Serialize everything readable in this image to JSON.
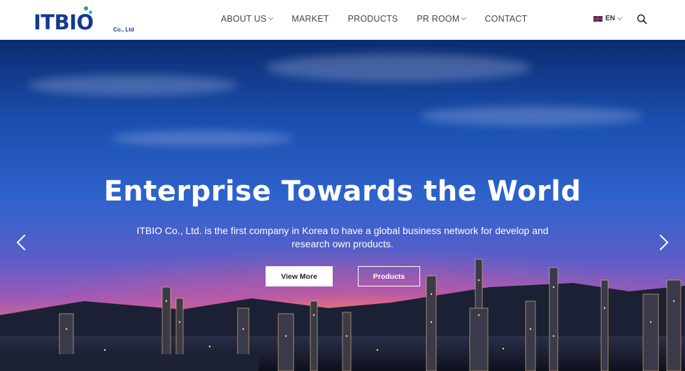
{
  "header": {
    "logo_text": "ITBIO",
    "logo_sub": "Co., Ltd",
    "nav": [
      {
        "label": "ABOUT US",
        "dropdown": true
      },
      {
        "label": "MARKET",
        "dropdown": false
      },
      {
        "label": "PRODUCTS",
        "dropdown": false
      },
      {
        "label": "PR ROOM",
        "dropdown": true
      },
      {
        "label": "CONTACT",
        "dropdown": false
      }
    ],
    "language": "EN"
  },
  "hero": {
    "title": "Enterprise Towards the World",
    "subtitle": "ITBIO Co., Ltd. is the first company in Korea to have a global business network for develop and research own products.",
    "primary_button": "View More",
    "secondary_button": "Products"
  },
  "colors": {
    "brand": "#14398f",
    "accent_green": "#1fa37a",
    "accent_teal": "#25b7c9"
  }
}
